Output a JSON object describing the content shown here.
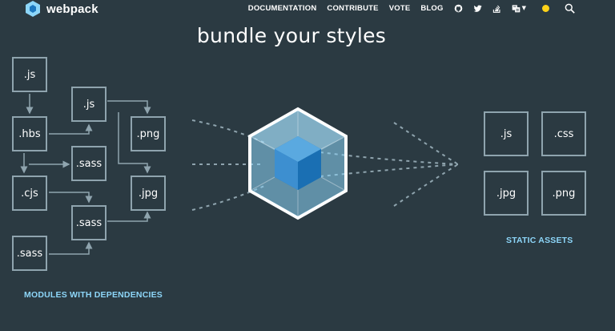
{
  "header": {
    "logo_text": "webpack",
    "nav": [
      {
        "label": "DOCUMENTATION"
      },
      {
        "label": "CONTRIBUTE"
      },
      {
        "label": "VOTE"
      },
      {
        "label": "BLOG"
      }
    ],
    "icons": [
      "github-icon",
      "twitter-icon",
      "stackoverflow-icon",
      "language-icon",
      "theme-toggle-icon",
      "search-icon"
    ],
    "theme_color": "#ffd219"
  },
  "hero": {
    "title": "bundle your styles"
  },
  "modules": {
    "caption": "MODULES WITH DEPENDENCIES",
    "items": [
      {
        "label": ".js"
      },
      {
        "label": ".js"
      },
      {
        "label": ".png"
      },
      {
        "label": ".hbs"
      },
      {
        "label": ".sass"
      },
      {
        "label": ".cjs"
      },
      {
        "label": ".jpg"
      },
      {
        "label": ".sass"
      },
      {
        "label": ".sass"
      }
    ]
  },
  "assets": {
    "caption": "STATIC ASSETS",
    "items": [
      {
        "label": ".js"
      },
      {
        "label": ".css"
      },
      {
        "label": ".jpg"
      },
      {
        "label": ".png"
      }
    ]
  },
  "colors": {
    "background": "#2b3a42",
    "box_border": "#8fa4ae",
    "caption": "#8dd6f9",
    "cube_outer": "#8dd6f9",
    "cube_inner": "#1c78c0"
  }
}
